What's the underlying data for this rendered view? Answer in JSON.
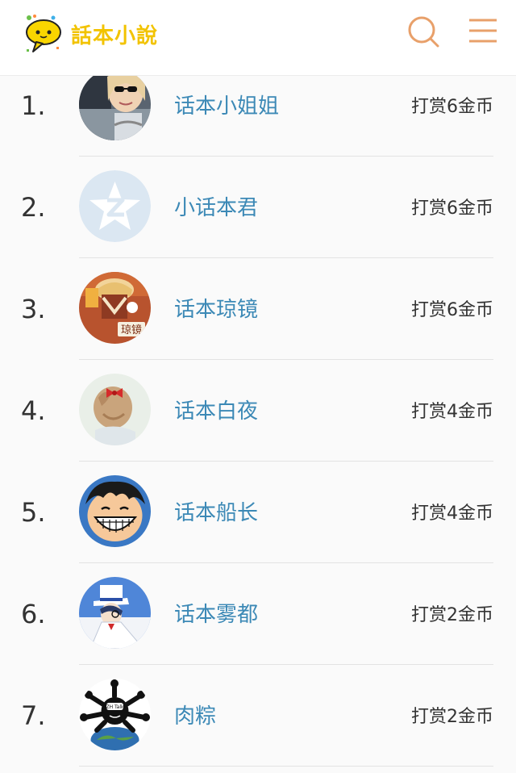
{
  "header": {
    "logo_text": "話本小說",
    "search_icon": "search-icon",
    "menu_icon": "hamburger-menu-icon",
    "accent_color": "#e8a06a",
    "logo_color": "#f2c300"
  },
  "reward_list": [
    {
      "rank": "1.",
      "name": "话本小姐姐",
      "reward": "打赏6金币",
      "avatar": "photo-woman-sunglasses"
    },
    {
      "rank": "2.",
      "name": "小话本君",
      "reward": "打赏6金币",
      "avatar": "default-qzone-avatar"
    },
    {
      "rank": "3.",
      "name": "话本琼镜",
      "reward": "打赏6金币",
      "avatar": "anime-character-琼镜"
    },
    {
      "rank": "4.",
      "name": "话本白夜",
      "reward": "打赏4金币",
      "avatar": "girl-hair-bow"
    },
    {
      "rank": "5.",
      "name": "话本船长",
      "reward": "打赏4金币",
      "avatar": "luffy-smile"
    },
    {
      "rank": "6.",
      "name": "话本雾都",
      "reward": "打赏2金币",
      "avatar": "kaito-kid"
    },
    {
      "rank": "7.",
      "name": "肉粽",
      "reward": "打赏2金币",
      "avatar": "globe-black-character"
    }
  ],
  "avatar_badges": {
    "qiongjing_label": "琼镜",
    "globe_badge": "ZH Talk"
  },
  "colors": {
    "name_link": "#3c89b6",
    "text": "#333333",
    "divider": "#e3e3e3"
  }
}
